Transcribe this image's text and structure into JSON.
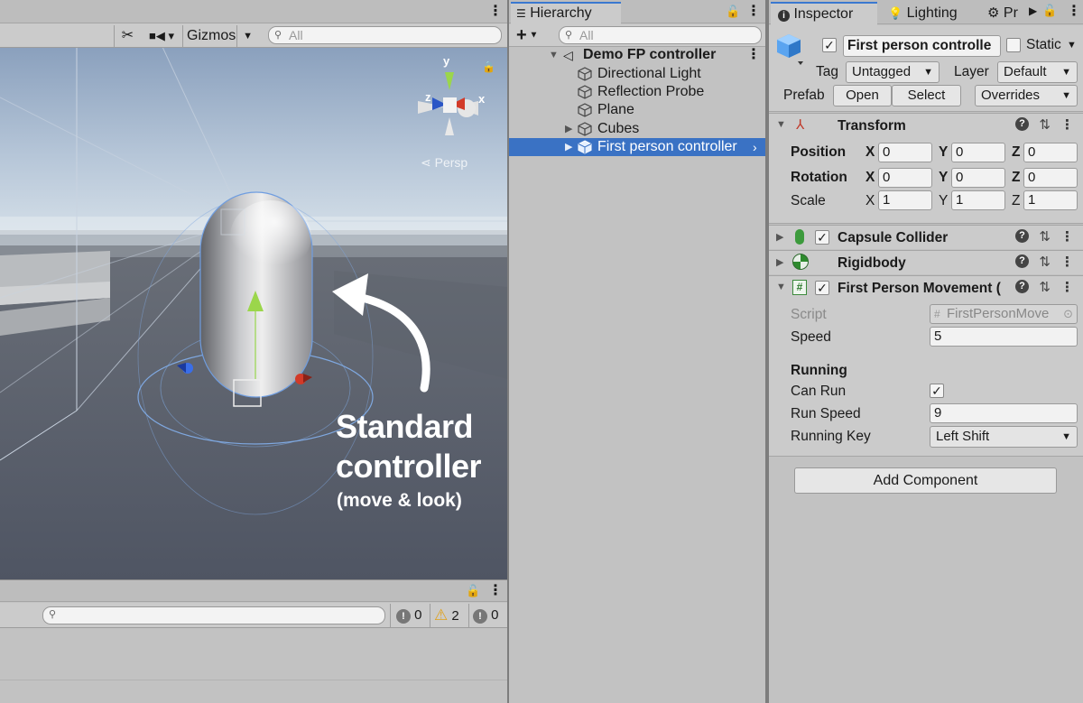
{
  "scene": {
    "toolbar": {
      "gizmos_label": "Gizmos",
      "search_placeholder": "All"
    },
    "persp_label": "Persp",
    "gizmo_axes": {
      "y": "y",
      "x": "x",
      "z": "z"
    },
    "annotation": {
      "line1": "Standard",
      "line2": "controller",
      "line3": "(move & look)"
    }
  },
  "console": {
    "error_count": "0",
    "warning_count": "2",
    "info_count": "0"
  },
  "hierarchy": {
    "tab_label": "Hierarchy",
    "search_placeholder": "All",
    "scene_name": "Demo FP controller",
    "items": [
      {
        "label": "Directional Light"
      },
      {
        "label": "Reflection Probe"
      },
      {
        "label": "Plane"
      },
      {
        "label": "Cubes"
      },
      {
        "label": "First person controller"
      }
    ]
  },
  "inspector": {
    "tabs": [
      {
        "label": "Inspector"
      },
      {
        "label": "Lighting"
      },
      {
        "label": "Pr"
      }
    ],
    "object_name": "First person controlle",
    "static_label": "Static",
    "tag_label": "Tag",
    "tag_value": "Untagged",
    "layer_label": "Layer",
    "layer_value": "Default",
    "prefab_label": "Prefab",
    "open_label": "Open",
    "select_label": "Select",
    "overrides_label": "Overrides",
    "transform": {
      "title": "Transform",
      "position_label": "Position",
      "rotation_label": "Rotation",
      "scale_label": "Scale",
      "axis_x": "X",
      "axis_y": "Y",
      "axis_z": "Z",
      "position": {
        "x": "0",
        "y": "0",
        "z": "0"
      },
      "rotation": {
        "x": "0",
        "y": "0",
        "z": "0"
      },
      "scale": {
        "x": "1",
        "y": "1",
        "z": "1"
      }
    },
    "capsule_title": "Capsule Collider",
    "rigidbody_title": "Rigidbody",
    "movement": {
      "title": "First Person Movement (",
      "script_label": "Script",
      "script_value": "FirstPersonMove",
      "speed_label": "Speed",
      "speed_value": "5",
      "running_header": "Running",
      "can_run_label": "Can Run",
      "run_speed_label": "Run Speed",
      "run_speed_value": "9",
      "running_key_label": "Running Key",
      "running_key_value": "Left Shift"
    },
    "add_component_label": "Add Component"
  }
}
